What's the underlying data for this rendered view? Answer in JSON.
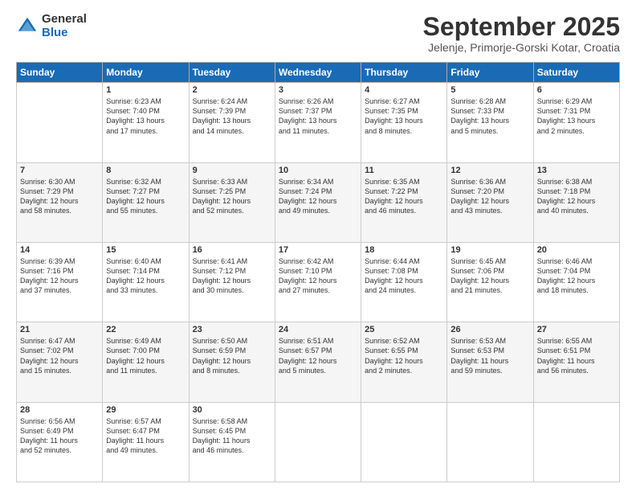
{
  "header": {
    "logo_general": "General",
    "logo_blue": "Blue",
    "month_title": "September 2025",
    "location": "Jelenje, Primorje-Gorski Kotar, Croatia"
  },
  "days_of_week": [
    "Sunday",
    "Monday",
    "Tuesday",
    "Wednesday",
    "Thursday",
    "Friday",
    "Saturday"
  ],
  "weeks": [
    [
      {
        "day": "",
        "info": ""
      },
      {
        "day": "1",
        "info": "Sunrise: 6:23 AM\nSunset: 7:40 PM\nDaylight: 13 hours\nand 17 minutes."
      },
      {
        "day": "2",
        "info": "Sunrise: 6:24 AM\nSunset: 7:39 PM\nDaylight: 13 hours\nand 14 minutes."
      },
      {
        "day": "3",
        "info": "Sunrise: 6:26 AM\nSunset: 7:37 PM\nDaylight: 13 hours\nand 11 minutes."
      },
      {
        "day": "4",
        "info": "Sunrise: 6:27 AM\nSunset: 7:35 PM\nDaylight: 13 hours\nand 8 minutes."
      },
      {
        "day": "5",
        "info": "Sunrise: 6:28 AM\nSunset: 7:33 PM\nDaylight: 13 hours\nand 5 minutes."
      },
      {
        "day": "6",
        "info": "Sunrise: 6:29 AM\nSunset: 7:31 PM\nDaylight: 13 hours\nand 2 minutes."
      }
    ],
    [
      {
        "day": "7",
        "info": "Sunrise: 6:30 AM\nSunset: 7:29 PM\nDaylight: 12 hours\nand 58 minutes."
      },
      {
        "day": "8",
        "info": "Sunrise: 6:32 AM\nSunset: 7:27 PM\nDaylight: 12 hours\nand 55 minutes."
      },
      {
        "day": "9",
        "info": "Sunrise: 6:33 AM\nSunset: 7:25 PM\nDaylight: 12 hours\nand 52 minutes."
      },
      {
        "day": "10",
        "info": "Sunrise: 6:34 AM\nSunset: 7:24 PM\nDaylight: 12 hours\nand 49 minutes."
      },
      {
        "day": "11",
        "info": "Sunrise: 6:35 AM\nSunset: 7:22 PM\nDaylight: 12 hours\nand 46 minutes."
      },
      {
        "day": "12",
        "info": "Sunrise: 6:36 AM\nSunset: 7:20 PM\nDaylight: 12 hours\nand 43 minutes."
      },
      {
        "day": "13",
        "info": "Sunrise: 6:38 AM\nSunset: 7:18 PM\nDaylight: 12 hours\nand 40 minutes."
      }
    ],
    [
      {
        "day": "14",
        "info": "Sunrise: 6:39 AM\nSunset: 7:16 PM\nDaylight: 12 hours\nand 37 minutes."
      },
      {
        "day": "15",
        "info": "Sunrise: 6:40 AM\nSunset: 7:14 PM\nDaylight: 12 hours\nand 33 minutes."
      },
      {
        "day": "16",
        "info": "Sunrise: 6:41 AM\nSunset: 7:12 PM\nDaylight: 12 hours\nand 30 minutes."
      },
      {
        "day": "17",
        "info": "Sunrise: 6:42 AM\nSunset: 7:10 PM\nDaylight: 12 hours\nand 27 minutes."
      },
      {
        "day": "18",
        "info": "Sunrise: 6:44 AM\nSunset: 7:08 PM\nDaylight: 12 hours\nand 24 minutes."
      },
      {
        "day": "19",
        "info": "Sunrise: 6:45 AM\nSunset: 7:06 PM\nDaylight: 12 hours\nand 21 minutes."
      },
      {
        "day": "20",
        "info": "Sunrise: 6:46 AM\nSunset: 7:04 PM\nDaylight: 12 hours\nand 18 minutes."
      }
    ],
    [
      {
        "day": "21",
        "info": "Sunrise: 6:47 AM\nSunset: 7:02 PM\nDaylight: 12 hours\nand 15 minutes."
      },
      {
        "day": "22",
        "info": "Sunrise: 6:49 AM\nSunset: 7:00 PM\nDaylight: 12 hours\nand 11 minutes."
      },
      {
        "day": "23",
        "info": "Sunrise: 6:50 AM\nSunset: 6:59 PM\nDaylight: 12 hours\nand 8 minutes."
      },
      {
        "day": "24",
        "info": "Sunrise: 6:51 AM\nSunset: 6:57 PM\nDaylight: 12 hours\nand 5 minutes."
      },
      {
        "day": "25",
        "info": "Sunrise: 6:52 AM\nSunset: 6:55 PM\nDaylight: 12 hours\nand 2 minutes."
      },
      {
        "day": "26",
        "info": "Sunrise: 6:53 AM\nSunset: 6:53 PM\nDaylight: 11 hours\nand 59 minutes."
      },
      {
        "day": "27",
        "info": "Sunrise: 6:55 AM\nSunset: 6:51 PM\nDaylight: 11 hours\nand 56 minutes."
      }
    ],
    [
      {
        "day": "28",
        "info": "Sunrise: 6:56 AM\nSunset: 6:49 PM\nDaylight: 11 hours\nand 52 minutes."
      },
      {
        "day": "29",
        "info": "Sunrise: 6:57 AM\nSunset: 6:47 PM\nDaylight: 11 hours\nand 49 minutes."
      },
      {
        "day": "30",
        "info": "Sunrise: 6:58 AM\nSunset: 6:45 PM\nDaylight: 11 hours\nand 46 minutes."
      },
      {
        "day": "",
        "info": ""
      },
      {
        "day": "",
        "info": ""
      },
      {
        "day": "",
        "info": ""
      },
      {
        "day": "",
        "info": ""
      }
    ]
  ]
}
